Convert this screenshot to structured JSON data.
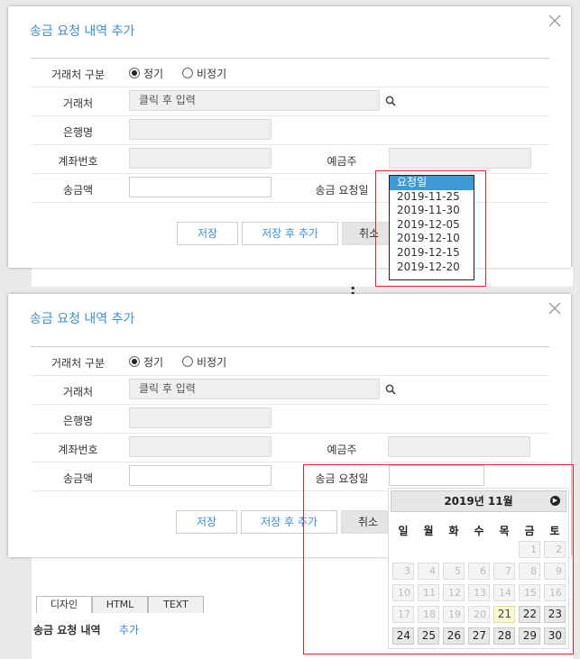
{
  "panels": [
    {
      "title": "송금 요청 내역 추가",
      "form": {
        "type_label": "거래처 구분",
        "type_options": [
          "정기",
          "비정기"
        ],
        "type_selected": 0,
        "client_label": "거래처",
        "client_placeholder": "클릭 후 입력",
        "bank_label": "은행명",
        "account_label": "계좌번호",
        "holder_label": "예금주",
        "amount_label": "송금액",
        "request_date_label": "송금 요청일"
      },
      "buttons": {
        "save": "저장",
        "save_and_add": "저장 후 추가",
        "cancel": "취소"
      }
    },
    {
      "title": "송금 요청 내역 추가",
      "form": {
        "type_label": "거래처 구분",
        "type_options": [
          "정기",
          "비정기"
        ],
        "type_selected": 0,
        "client_label": "거래처",
        "client_placeholder": "클릭 후 입력",
        "bank_label": "은행명",
        "account_label": "계좌번호",
        "holder_label": "예금주",
        "amount_label": "송금액",
        "request_date_label": "송금 요청일"
      },
      "buttons": {
        "save": "저장",
        "save_and_add": "저장 후 추가",
        "cancel": "취소"
      }
    }
  ],
  "dropdown": {
    "options": [
      "요청일",
      "2019-11-25",
      "2019-11-30",
      "2019-12-05",
      "2019-12-10",
      "2019-12-15",
      "2019-12-20"
    ],
    "selected": 0
  },
  "calendar": {
    "month_label": "2019년 11월",
    "weekdays": [
      "일",
      "월",
      "화",
      "수",
      "목",
      "금",
      "토"
    ],
    "weeks": [
      [
        null,
        null,
        null,
        null,
        null,
        "1",
        "2"
      ],
      [
        "3",
        "4",
        "5",
        "6",
        "7",
        "8",
        "9"
      ],
      [
        "10",
        "11",
        "12",
        "13",
        "14",
        "15",
        "16"
      ],
      [
        "17",
        "18",
        "19",
        "20",
        "21",
        "22",
        "23"
      ],
      [
        "24",
        "25",
        "26",
        "27",
        "28",
        "29",
        "30"
      ]
    ],
    "first_enabled_day": 21,
    "today": 21
  },
  "background": {
    "tabs": [
      "디자인",
      "HTML",
      "TEXT"
    ],
    "section_title": "송금 요청 내역",
    "section_link": "추가"
  },
  "colors": {
    "accent": "#3a8fd0",
    "highlight_box": "#e0262b",
    "selection": "#3d9ad7"
  }
}
